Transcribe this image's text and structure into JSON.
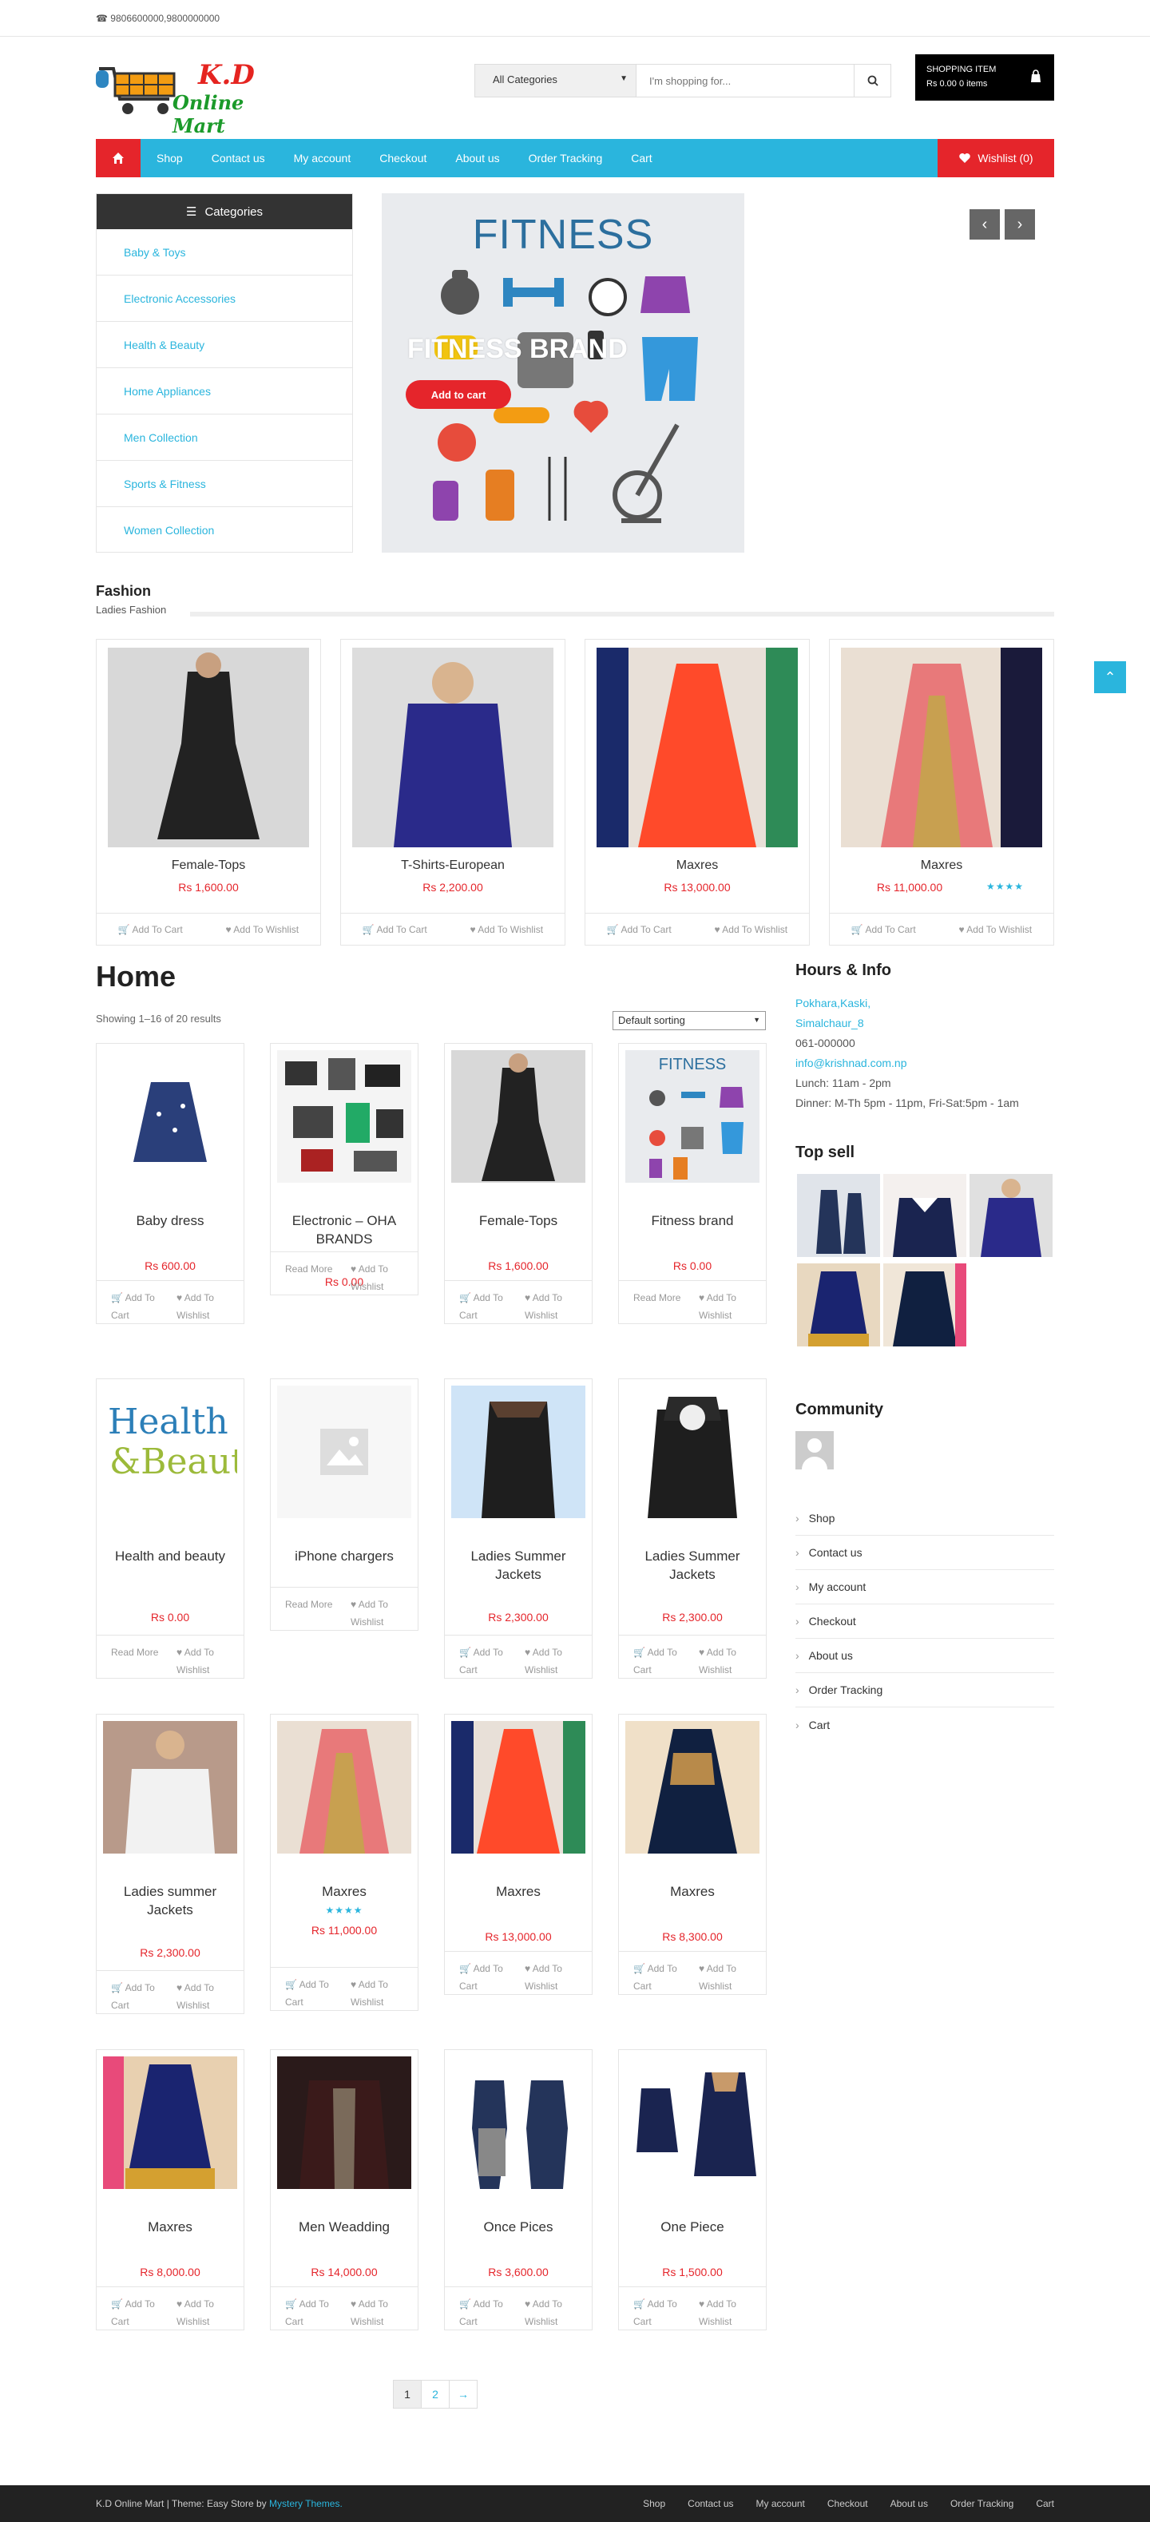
{
  "topbar": {
    "phone": "9806600000,9800000000"
  },
  "logo": {
    "line1": "K.D",
    "line2": "Online Mart"
  },
  "search": {
    "category": "All Categories",
    "placeholder": "I'm shopping for..."
  },
  "cart": {
    "title": "SHOPPING ITEM",
    "summary": "Rs 0.00 0 items"
  },
  "nav": {
    "items": [
      "Shop",
      "Contact us",
      "My account",
      "Checkout",
      "About us",
      "Order Tracking",
      "Cart"
    ],
    "wishlist": "Wishlist (0)"
  },
  "categories": {
    "title": "Categories",
    "items": [
      "Baby & Toys",
      "Electronic Accessories",
      "Health & Beauty",
      "Home Appliances",
      "Men Collection",
      "Sports & Fitness",
      "Women Collection"
    ]
  },
  "banner": {
    "fitness": "FITNESS",
    "brand": "FITNESS BRAND",
    "button": "Add to cart"
  },
  "fashion": {
    "title": "Fashion",
    "subtitle": "Ladies Fashion",
    "products": [
      {
        "name": "Female-Tops",
        "price": "Rs 1,600.00"
      },
      {
        "name": "T-Shirts-European",
        "price": "Rs 2,200.00"
      },
      {
        "name": "Maxres",
        "price": "Rs 13,000.00"
      },
      {
        "name": "Maxres",
        "price": "Rs 11,000.00",
        "rating": "4"
      }
    ],
    "add_to_cart": "Add To Cart",
    "add_to_wishlist": "Add To Wishlist"
  },
  "home": {
    "title": "Home",
    "showing": "Showing 1–16 of 20 results",
    "sort": "Default sorting",
    "products": [
      {
        "name": "Baby dress",
        "price": "Rs 600.00",
        "a1": "Add To Cart",
        "a2": "Add To Wishlist"
      },
      {
        "name": "Electronic – OHA BRANDS",
        "price": "Rs 0.00",
        "a1": "Read More",
        "a2": "Add To Wishlist"
      },
      {
        "name": "Female-Tops",
        "price": "Rs 1,600.00",
        "a1": "Add To Cart",
        "a2": "Add To Wishlist"
      },
      {
        "name": "Fitness brand",
        "price": "Rs 0.00",
        "a1": "Read More",
        "a2": "Add To Wishlist"
      },
      {
        "name": "Health and beauty",
        "price": "Rs 0.00",
        "a1": "Read More",
        "a2": "Add To Wishlist"
      },
      {
        "name": "iPhone chargers",
        "price": "",
        "a1": "Read More",
        "a2": "Add To Wishlist"
      },
      {
        "name": "Ladies Summer Jackets",
        "price": "Rs 2,300.00",
        "a1": "Add To Cart",
        "a2": "Add To Wishlist"
      },
      {
        "name": "Ladies Summer Jackets",
        "price": "Rs 2,300.00",
        "a1": "Add To Cart",
        "a2": "Add To Wishlist"
      },
      {
        "name": "Ladies summer Jackets",
        "price": "Rs 2,300.00",
        "a1": "Add To Cart",
        "a2": "Add To Wishlist"
      },
      {
        "name": "Maxres",
        "price": "Rs 11,000.00",
        "a1": "Add To Cart",
        "a2": "Add To Wishlist",
        "rating": "4"
      },
      {
        "name": "Maxres",
        "price": "Rs 13,000.00",
        "a1": "Add To Cart",
        "a2": "Add To Wishlist"
      },
      {
        "name": "Maxres",
        "price": "Rs 8,300.00",
        "a1": "Add To Cart",
        "a2": "Add To Wishlist"
      },
      {
        "name": "Maxres",
        "price": "Rs 8,000.00",
        "a1": "Add To Cart",
        "a2": "Add To Wishlist"
      },
      {
        "name": "Men Weadding",
        "price": "Rs 14,000.00",
        "a1": "Add To Cart",
        "a2": "Add To Wishlist"
      },
      {
        "name": "Once Pices",
        "price": "Rs 3,600.00",
        "a1": "Add To Cart",
        "a2": "Add To Wishlist"
      },
      {
        "name": "One Piece",
        "price": "Rs 1,500.00",
        "a1": "Add To Cart",
        "a2": "Add To Wishlist"
      }
    ]
  },
  "sidebar": {
    "hours_title": "Hours & Info",
    "address1": "Pokhara,Kaski,",
    "address2": "Simalchaur_8",
    "phone": "061-000000",
    "email": "info@krishnad.com.np",
    "lunch": "Lunch: 11am - 2pm",
    "dinner": "Dinner: M-Th 5pm - 11pm, Fri-Sat:5pm - 1am",
    "topsell_title": "Top sell",
    "community_title": "Community",
    "links": [
      "Shop",
      "Contact us",
      "My account",
      "Checkout",
      "About us",
      "Order Tracking",
      "Cart"
    ]
  },
  "pager": {
    "p1": "1",
    "p2": "2",
    "next": "→"
  },
  "footer": {
    "text": "K.D Online Mart | Theme: Easy Store by",
    "theme_link": "Mystery Themes.",
    "links": [
      "Shop",
      "Contact us",
      "My account",
      "Checkout",
      "About us",
      "Order Tracking",
      "Cart"
    ]
  },
  "colors": {
    "accent": "#2ab5dd",
    "red": "#e5252b",
    "dark": "#333333"
  }
}
